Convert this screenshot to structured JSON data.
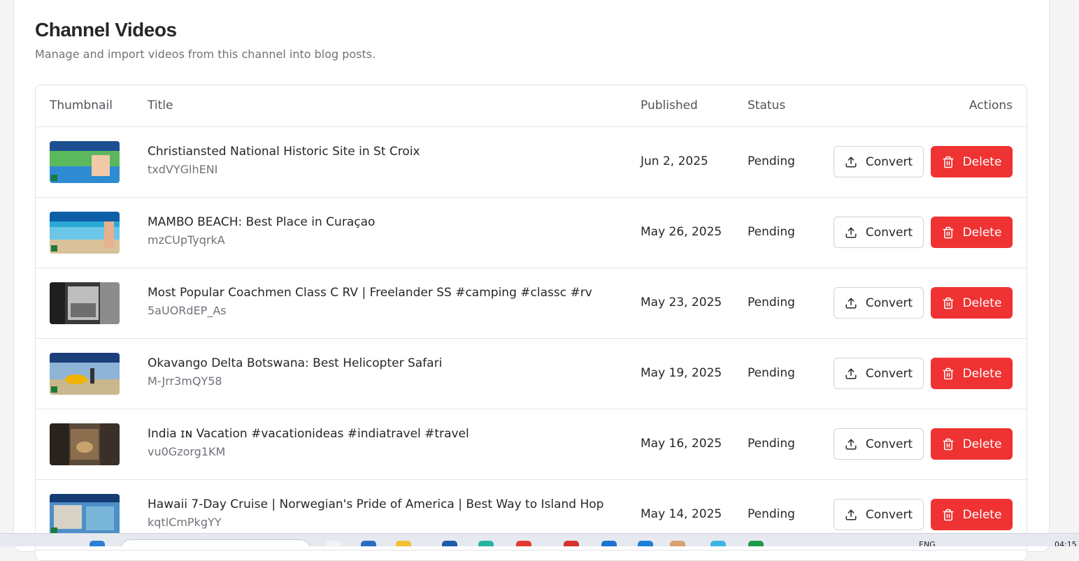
{
  "header": {
    "title": "Channel Videos",
    "subtitle": "Manage and import videos from this channel into blog posts."
  },
  "table": {
    "columns": {
      "thumbnail": "Thumbnail",
      "title": "Title",
      "published": "Published",
      "status": "Status",
      "actions": "Actions"
    },
    "rows": [
      {
        "title": "Christiansted National Historic Site in St Croix",
        "id": "txdVYGlhENI",
        "published": "Jun 2, 2025",
        "status": "Pending",
        "convert_label": "Convert",
        "delete_label": "Delete"
      },
      {
        "title": "MAMBO BEACH: Best Place in Curaçao",
        "id": "mzCUpTyqrkA",
        "published": "May 26, 2025",
        "status": "Pending",
        "convert_label": "Convert",
        "delete_label": "Delete"
      },
      {
        "title": "Most Popular Coachmen Class C RV | Freelander SS #camping #classc #rv",
        "id": "5aUORdEP_As",
        "published": "May 23, 2025",
        "status": "Pending",
        "convert_label": "Convert",
        "delete_label": "Delete"
      },
      {
        "title": "Okavango Delta Botswana: Best Helicopter Safari",
        "id": "M-Jrr3mQY58",
        "published": "May 19, 2025",
        "status": "Pending",
        "convert_label": "Convert",
        "delete_label": "Delete"
      },
      {
        "title": "India ɪɴ Vacation #vacationideas #indiatravel #travel",
        "id": "vu0Gzorg1KM",
        "published": "May 16, 2025",
        "status": "Pending",
        "convert_label": "Convert",
        "delete_label": "Delete"
      },
      {
        "title": "Hawaii 7-Day Cruise | Norwegian's Pride of America | Best Way to Island Hop",
        "id": "kqtlCmPkgYY",
        "published": "May 14, 2025",
        "status": "Pending",
        "convert_label": "Convert",
        "delete_label": "Delete"
      }
    ]
  },
  "icons": {
    "convert": "upload-icon",
    "delete": "trash-icon"
  },
  "colors": {
    "delete": "#ef3232",
    "border": "#e4e4e7"
  },
  "taskbar": {
    "language": "ENG",
    "time": "04:15"
  }
}
